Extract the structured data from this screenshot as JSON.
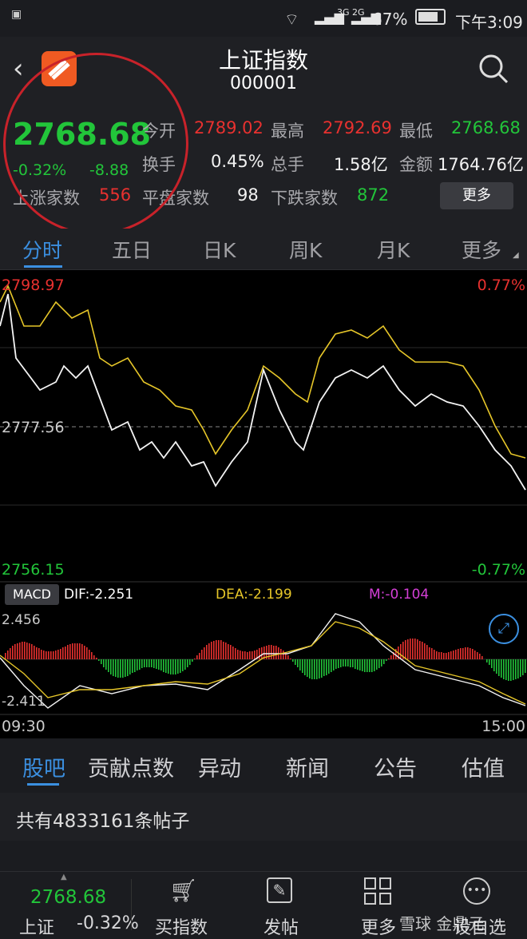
{
  "status": {
    "battery": "67%",
    "time": "下午3:09",
    "net": "3G 2G"
  },
  "header": {
    "title": "上证指数",
    "code": "000001"
  },
  "quote": {
    "price": "2768.68",
    "change_pct": "-0.32%",
    "change": "-8.88",
    "rise_label": "上涨家数",
    "rise_count": "556",
    "open_label": "今开",
    "open": "2789.02",
    "high_label": "最高",
    "high": "2792.69",
    "low_label": "最低",
    "low": "2768.68",
    "turnover_label": "换手",
    "turnover": "0.45%",
    "volume_label": "总手",
    "volume": "1.58亿",
    "amount_label": "金额",
    "amount": "1764.76亿",
    "flat_label": "平盘家数",
    "flat_count": "98",
    "fall_label": "下跌家数",
    "fall_count": "872",
    "more": "更多"
  },
  "chart_tabs": [
    "分时",
    "五日",
    "日K",
    "周K",
    "月K",
    "更多"
  ],
  "chart": {
    "top_price": "2798.97",
    "top_pct": "0.77%",
    "mid_price": "2777.56",
    "bottom_price": "2756.15",
    "bottom_pct": "-0.77%",
    "macd_label": "MACD",
    "dif": "DIF:-2.251",
    "dea": "DEA:-2.199",
    "m": "M:-0.104",
    "macd_top": "2.456",
    "macd_bottom": "-2.411",
    "time_start": "09:30",
    "time_end": "15:00"
  },
  "news_tabs": [
    "股吧",
    "贡献点数",
    "异动",
    "新闻",
    "公告",
    "估值"
  ],
  "posts": "共有4833161条帖子",
  "bottom_bar": {
    "index_price": "2768.68",
    "index_name": "上证",
    "index_pct": "-0.32%",
    "buy": "买指数",
    "post": "发帖",
    "more": "更多",
    "settings": "设自选",
    "watermark": "雪球 金鼎元"
  },
  "colors": {
    "up": "#e8312f",
    "down": "#22c53a",
    "accent": "#3b8fe0",
    "avg_line": "#e6c629"
  }
}
